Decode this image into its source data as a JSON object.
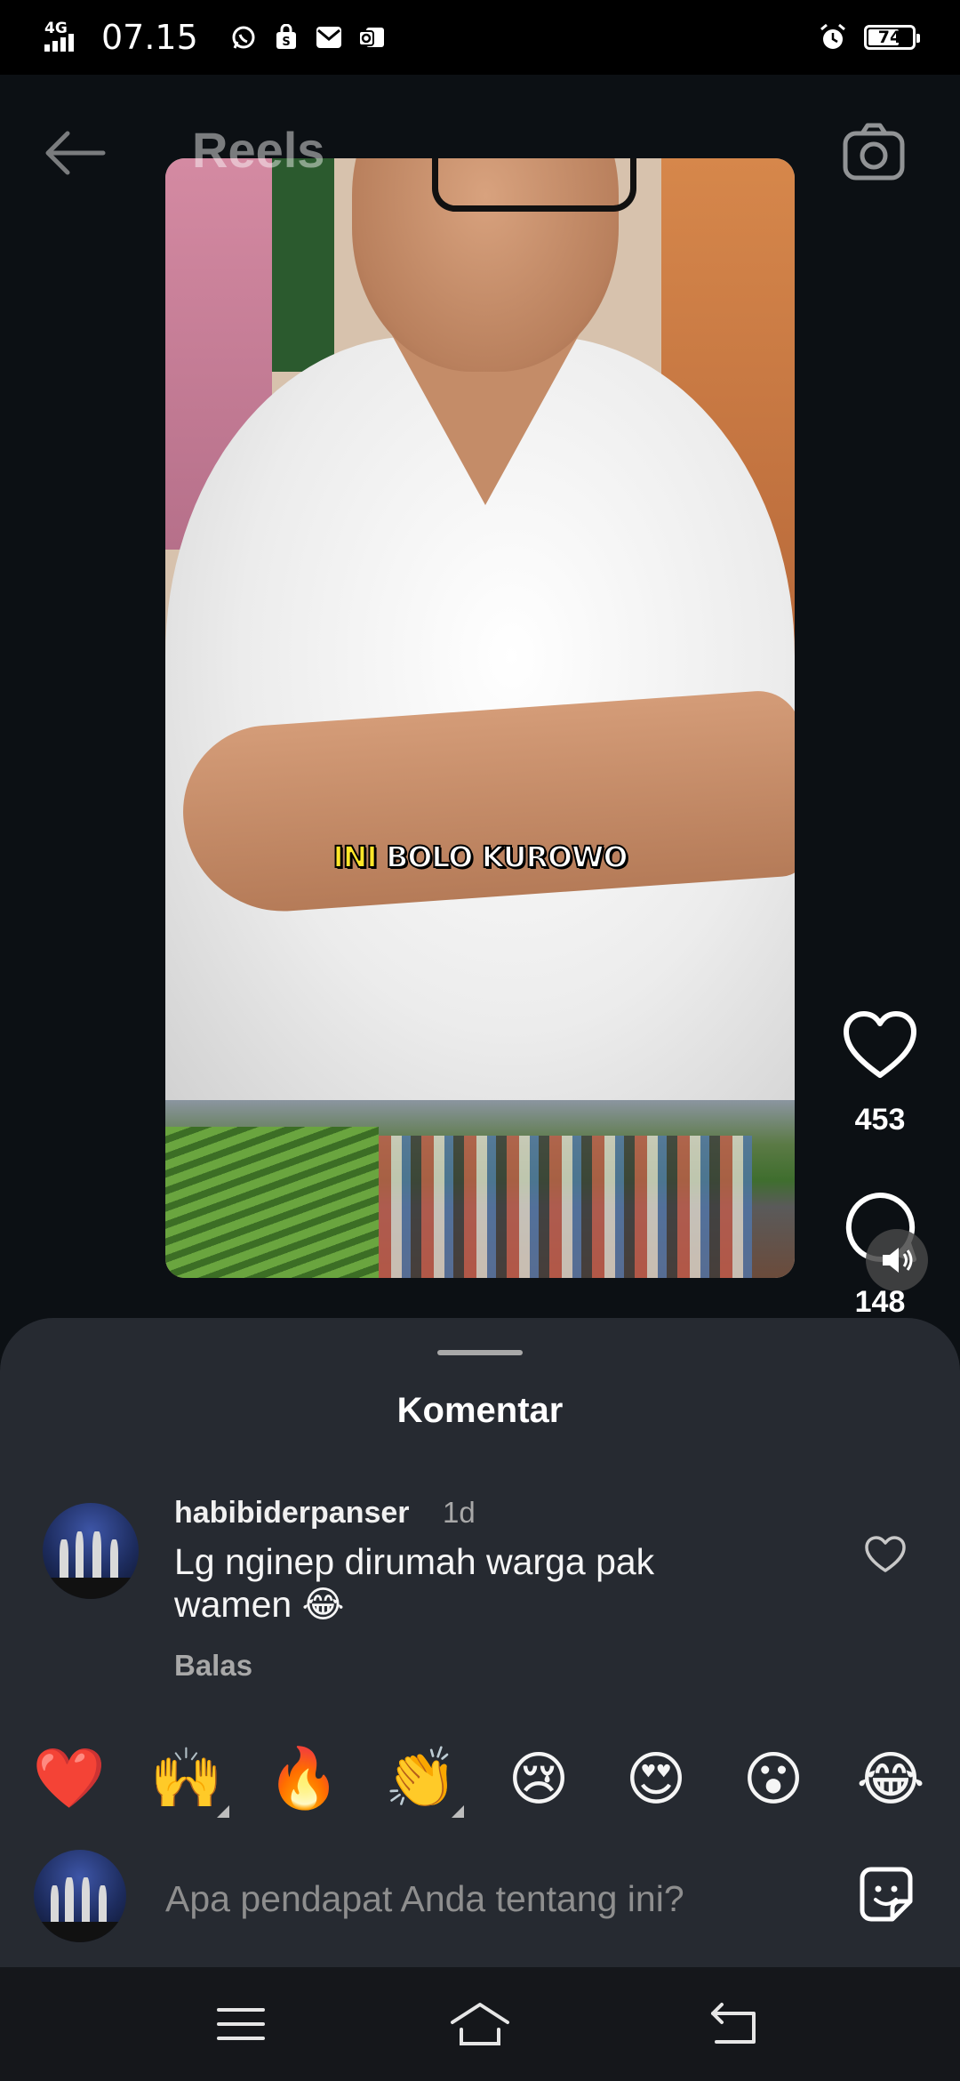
{
  "status_bar": {
    "network": "4G",
    "time": "07.15",
    "battery": "74",
    "battery_level": 0.74
  },
  "header": {
    "title": "Reels"
  },
  "video": {
    "caption_highlight": "INI",
    "caption_rest": "BOLO KUROWO"
  },
  "actions": {
    "like_count": "453",
    "comment_count": "148"
  },
  "comments_sheet": {
    "title": "Komentar",
    "comments": [
      {
        "username": "habibiderpanser",
        "time": "1d",
        "text": "Lg nginep dirumah warga pak wamen 😂",
        "reply_label": "Balas"
      }
    ],
    "quick_reactions": [
      "❤️",
      "🙌",
      "🔥",
      "👏",
      "😢",
      "😍",
      "😮",
      "😂"
    ],
    "input_placeholder": "Apa pendapat Anda tentang ini?"
  },
  "icons": {
    "back": "arrow-left-icon",
    "camera": "camera-icon",
    "like": "heart-outline-icon",
    "comment": "speech-bubble-icon",
    "mute": "speaker-muted-icon",
    "sticker": "sticker-icon",
    "nav_menu": "hamburger-icon",
    "nav_home": "home-icon",
    "nav_back": "back-icon"
  },
  "colors": {
    "background": "#0c1014",
    "sheet": "#262a31",
    "heart_red": "#e0132b",
    "caption_yellow": "#ffe629"
  }
}
